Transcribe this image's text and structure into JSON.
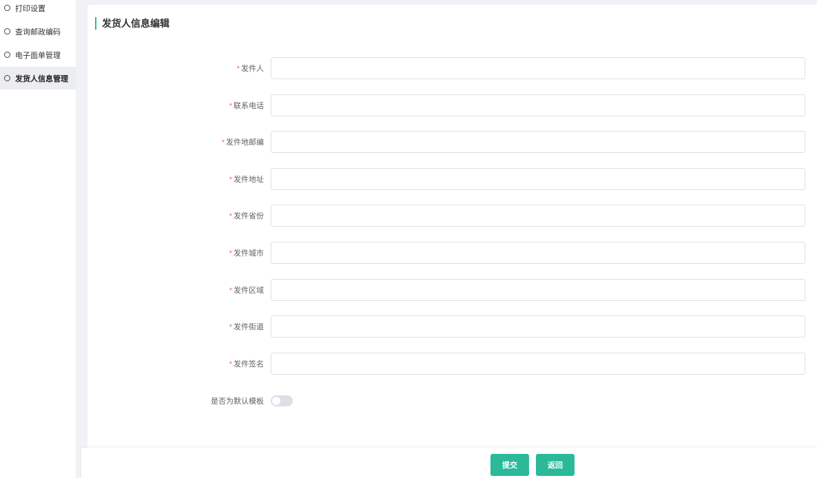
{
  "sidebar": {
    "items": [
      {
        "label": "打印设置",
        "active": false
      },
      {
        "label": "查询邮政编码",
        "active": false
      },
      {
        "label": "电子面单管理",
        "active": false
      },
      {
        "label": "发货人信息管理",
        "active": true
      }
    ]
  },
  "page": {
    "title": "发货人信息编辑"
  },
  "form": {
    "required_mark": "*",
    "fields": [
      {
        "label": "发件人",
        "value": ""
      },
      {
        "label": "联系电话",
        "value": ""
      },
      {
        "label": "发件地邮编",
        "value": ""
      },
      {
        "label": "发件地址",
        "value": ""
      },
      {
        "label": "发件省份",
        "value": ""
      },
      {
        "label": "发件城市",
        "value": ""
      },
      {
        "label": "发件区域",
        "value": ""
      },
      {
        "label": "发件街道",
        "value": ""
      },
      {
        "label": "发件签名",
        "value": ""
      }
    ],
    "default_template": {
      "label": "是否为默认模板",
      "on": false
    }
  },
  "footer": {
    "submit_label": "提交",
    "back_label": "返回"
  },
  "colors": {
    "accent": "#2bb99a",
    "required": "#f56c6c"
  }
}
